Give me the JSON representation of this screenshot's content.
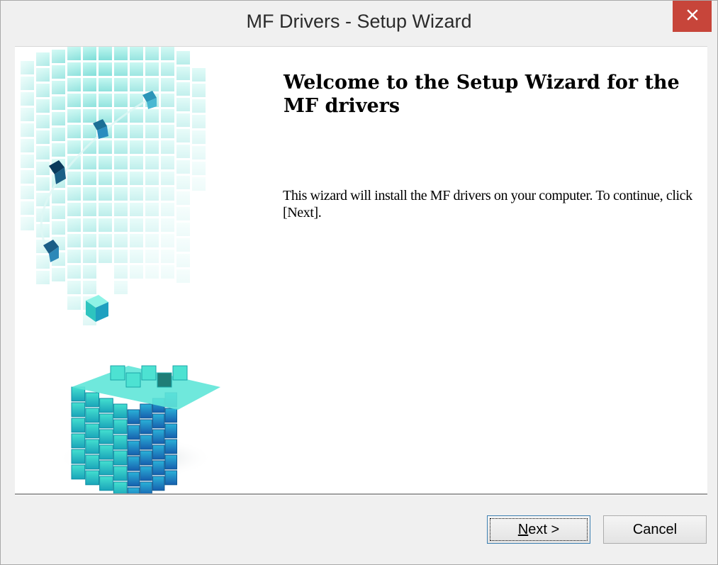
{
  "window": {
    "title": "MF Drivers - Setup Wizard"
  },
  "content": {
    "heading": "Welcome to the Setup Wizard for the MF drivers",
    "description": "This wizard will install the MF drivers on your computer. To continue, click [Next]."
  },
  "buttons": {
    "next_label": "Next >",
    "cancel_label": "Cancel"
  },
  "icons": {
    "close": "close-icon"
  },
  "colors": {
    "close_button": "#c7453a",
    "artwork_teal": "#2ad4c8",
    "artwork_blue": "#2a8bd6"
  }
}
